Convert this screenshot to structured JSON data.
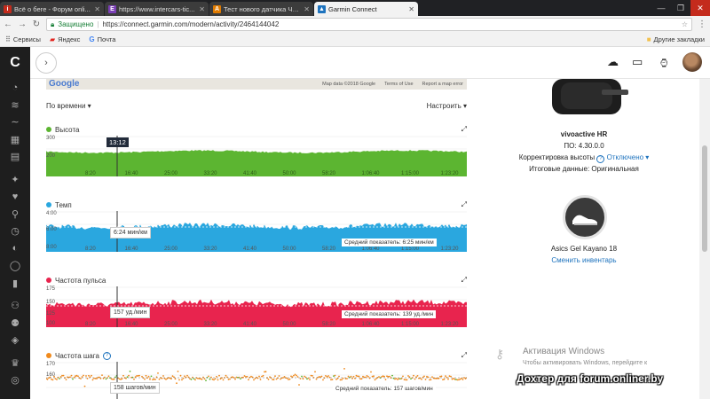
{
  "browser": {
    "tabs": [
      {
        "title": "Всё о беге - Форум onli...",
        "favicon_color": "#c42b1c",
        "favicon_letter": "i",
        "active": false
      },
      {
        "title": "https://www.intercars-tic...",
        "favicon_color": "#7a3fb5",
        "favicon_letter": "E",
        "active": false
      },
      {
        "title": "Тест нового датчика ЧС...",
        "favicon_color": "#e07b00",
        "favicon_letter": "A",
        "active": false
      },
      {
        "title": "Garmin Connect",
        "favicon_color": "#1e73be",
        "favicon_letter": "▲",
        "active": true
      }
    ],
    "address": {
      "secure_label": "Защищено",
      "url": "https://connect.garmin.com/modern/activity/2464144042"
    },
    "bookmarks": [
      {
        "label": "Сервисы",
        "icon": "apps-icon"
      },
      {
        "label": "Яндекс",
        "icon": "yandex-icon"
      },
      {
        "label": "Почта",
        "icon": "google-icon"
      }
    ],
    "other_bookmarks": "Другие закладки"
  },
  "map": {
    "logo": "Google",
    "data": "Map data ©2018 Google",
    "terms": "Terms of Use",
    "report": "Report a map error"
  },
  "controls": {
    "sort_label": "По времени",
    "settings_label": "Настроить"
  },
  "charts": {
    "x_ticks": [
      "8:20",
      "16:40",
      "25:00",
      "33:20",
      "41:40",
      "50:00",
      "58:20",
      "1:06:40",
      "1:15:00",
      "1:23:20"
    ],
    "elevation": {
      "title": "Высота",
      "color": "#5cb531",
      "y_top": "300",
      "y_mid": "200",
      "hover_time": "13:12"
    },
    "pace": {
      "title": "Темп",
      "color": "#2aa7df",
      "y_top": "4:00",
      "y_mid": "6:00",
      "y_bot": "8:00",
      "tooltip": "6:24 мин/км",
      "avg": "Средний показатель: 6:25 мин/км"
    },
    "hr": {
      "title": "Частота пульса",
      "color": "#e8244e",
      "y_top": "175",
      "y_mid": "150",
      "y_low": "125",
      "y_bot": "100",
      "tooltip": "157 уд./мин",
      "avg": "Средний показатель: 139 уд./мин"
    },
    "cadence": {
      "title": "Частота шага",
      "color": "#f08a1c",
      "y_top": "170",
      "y_mid": "160",
      "tooltip": "158 шагов/мин",
      "avg": "Средний показатель: 157 шагов/мин"
    }
  },
  "device": {
    "name": "vivoactive HR",
    "sw": "ПО: 4.30.0.0",
    "elev_corr_label": "Корректировка высоты",
    "elev_corr_value": "Отключено",
    "final_data": "Итоговые данные: Оригинальная"
  },
  "gear": {
    "name": "Asics Gel Kayano 18",
    "change_link": "Сменить инвентарь"
  },
  "activation": {
    "title": "Активация Windows",
    "subtitle": "Чтобы активировать Windows, перейдите к"
  },
  "watermark": "Дохтер для forum.onliner.by"
}
